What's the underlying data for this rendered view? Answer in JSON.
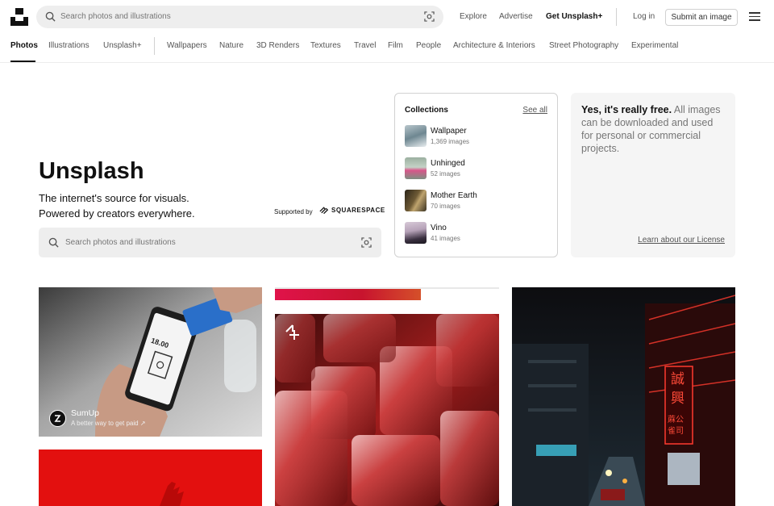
{
  "header": {
    "search_placeholder": "Search photos and illustrations",
    "nav": [
      "Explore",
      "Advertise",
      "Get Unsplash+"
    ],
    "login": "Log in",
    "submit": "Submit an image"
  },
  "categories": [
    "Photos",
    "Illustrations",
    "Unsplash+",
    "Wallpapers",
    "Nature",
    "3D Renders",
    "Textures",
    "Travel",
    "Film",
    "People",
    "Architecture & Interiors",
    "Street Photography",
    "Experimental"
  ],
  "hero": {
    "title": "Unsplash",
    "line1": "The internet's source for visuals.",
    "line2": "Powered by creators everywhere.",
    "supported_by": "Supported by",
    "sponsor_brand": "SQUARESPACE",
    "search_placeholder": "Search photos and illustrations"
  },
  "collections": {
    "heading": "Collections",
    "see_all": "See all",
    "items": [
      {
        "name": "Wallpaper",
        "count": "1,369 images"
      },
      {
        "name": "Unhinged",
        "count": "52 images"
      },
      {
        "name": "Mother Earth",
        "count": "70 images"
      },
      {
        "name": "Vino",
        "count": "41 images"
      }
    ]
  },
  "free_card": {
    "bold": "Yes, it's really free.",
    "rest": " All images can be downloaded and used for personal or commercial projects.",
    "license": "Learn about our License"
  },
  "photos": {
    "sponsor_name": "SumUp",
    "sponsor_tagline": "A better way to get paid ↗",
    "phone_amount": "18.00",
    "neon_chars": "誠興",
    "neon_small": "蔴公雀司"
  },
  "colors": {
    "accent_red": "#e3100f",
    "gray_bg": "#eeeeee",
    "text_muted": "#767676"
  }
}
